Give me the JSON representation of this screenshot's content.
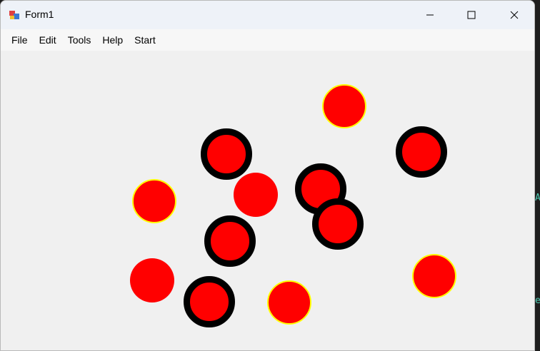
{
  "window": {
    "title": "Form1"
  },
  "menu": {
    "items": [
      "File",
      "Edit",
      "Tools",
      "Help",
      "Start"
    ]
  },
  "caption_buttons": {
    "minimize_icon": "minimize-icon",
    "maximize_icon": "maximize-icon",
    "close_icon": "close-icon"
  },
  "colors": {
    "ball_fill": "#ff0000",
    "ball_outline_yellow": "#ffff00",
    "ball_outline_black": "#000000",
    "client_background": "#f0f0f0"
  },
  "canvas": {
    "balls": [
      {
        "style": "yellow-outline"
      },
      {
        "style": "black-outline"
      },
      {
        "style": "black-outline"
      },
      {
        "style": "yellow-outline"
      },
      {
        "style": "plain"
      },
      {
        "style": "black-outline"
      },
      {
        "style": "black-outline"
      },
      {
        "style": "black-outline"
      },
      {
        "style": "plain"
      },
      {
        "style": "black-outline"
      },
      {
        "style": "yellow-outline"
      },
      {
        "style": "yellow-outline"
      }
    ]
  },
  "background_edge": {
    "glyphs": [
      "A",
      "e"
    ]
  }
}
